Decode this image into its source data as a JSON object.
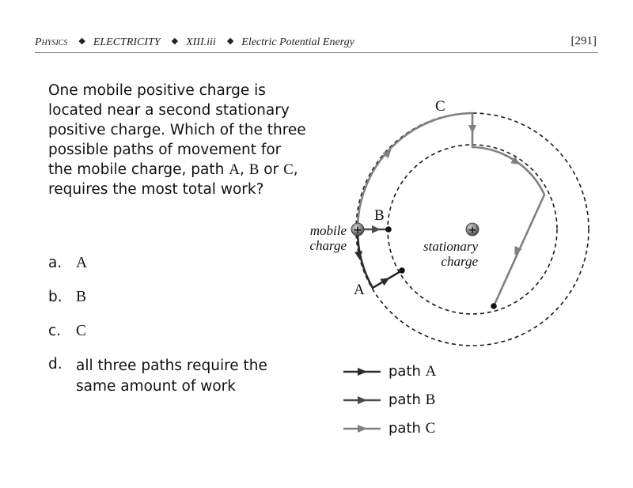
{
  "header": {
    "subject": "Physics",
    "topic": "ELECTRICITY",
    "section": "XIII.iii",
    "title": "Electric Potential Energy",
    "page_number": "[291]",
    "separator_icon": "diamond-bullet-icon"
  },
  "question": {
    "text_part1": "One mobile positive charge is located near a second stationary positive charge.  Which of the three possible paths of movement for the mobile charge, path ",
    "path_a": "A",
    "sep1": ", ",
    "path_b": "B",
    "text_or": " or ",
    "path_c": "C",
    "text_part2": ", requires the most total work?"
  },
  "answers": [
    {
      "letter": "a.",
      "value": "A"
    },
    {
      "letter": "b.",
      "value": "B"
    },
    {
      "letter": "c.",
      "value": "C"
    },
    {
      "letter": "d.",
      "value": "all three paths require the same amount of work"
    }
  ],
  "diagram": {
    "mobile_label_line1": "mobile",
    "mobile_label_line2": "charge",
    "stationary_label_line1": "stationary",
    "stationary_label_line2": "charge",
    "path_labels": {
      "a": "A",
      "b": "B",
      "c": "C"
    },
    "charge_symbol": "+",
    "colors": {
      "path_a": "#2b2b2b",
      "path_b": "#4a4a4a",
      "path_c": "#808080",
      "dashed_circles": "#1a1a1a"
    }
  },
  "legend": [
    {
      "prefix": "path ",
      "label": "A",
      "color": "#2b2b2b"
    },
    {
      "prefix": "path ",
      "label": "B",
      "color": "#4a4a4a"
    },
    {
      "prefix": "path ",
      "label": "C",
      "color": "#808080"
    }
  ]
}
